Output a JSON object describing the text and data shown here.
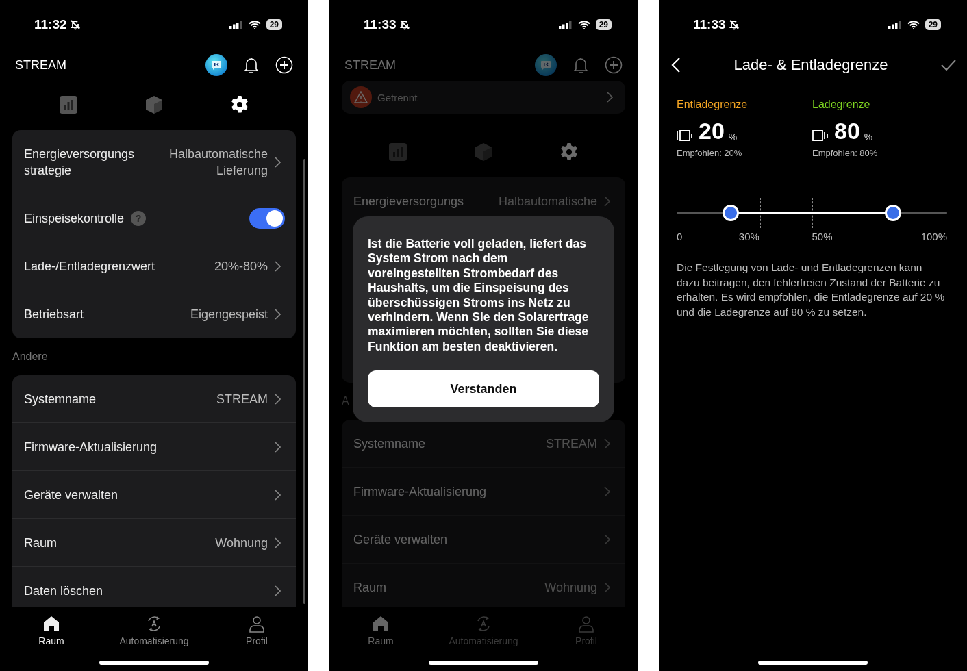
{
  "screens": [
    {
      "kind": "settings",
      "status_bar": {
        "time": "11:32",
        "battery": "29"
      },
      "header": {
        "title": "STREAM"
      },
      "view_tabs": [
        {
          "kind": "chart",
          "selected": false
        },
        {
          "kind": "cube",
          "selected": false
        },
        {
          "kind": "gear",
          "selected": true
        }
      ],
      "groups": [
        {
          "rows": [
            {
              "kind": "nav",
              "label": "Energieversorgungs strategie",
              "value": "Halbautomatische Lieferung"
            },
            {
              "kind": "toggle",
              "label": "Einspeisekontrolle",
              "help": "?",
              "on": true
            },
            {
              "kind": "nav",
              "label": "Lade-/Entladegrenzwert",
              "value": "20%-80%"
            },
            {
              "kind": "nav",
              "label": "Betriebsart",
              "value": "Eigengespeist"
            }
          ]
        },
        {
          "label": "Andere",
          "rows": [
            {
              "kind": "nav",
              "label": "Systemname",
              "value": "STREAM"
            },
            {
              "kind": "nav",
              "label": "Firmware-Aktualisierung"
            },
            {
              "kind": "nav",
              "label": "Geräte verwalten"
            },
            {
              "kind": "nav",
              "label": "Raum",
              "value": "Wohnung"
            },
            {
              "kind": "nav",
              "label": "Daten löschen"
            }
          ]
        }
      ],
      "bottom_nav": [
        {
          "kind": "home",
          "label": "Raum",
          "selected": true
        },
        {
          "kind": "automation",
          "label": "Automatisierung",
          "selected": false
        },
        {
          "kind": "profile",
          "label": "Profil",
          "selected": false
        }
      ]
    },
    {
      "kind": "settings",
      "status_bar": {
        "time": "11:33",
        "battery": "29"
      },
      "header": {
        "title": "STREAM"
      },
      "alert_banner": {
        "text": "Getrennt"
      },
      "view_tabs": [
        {
          "kind": "chart",
          "selected": false
        },
        {
          "kind": "cube",
          "selected": false
        },
        {
          "kind": "gear",
          "selected": true
        }
      ],
      "groups": [
        {
          "rows": [
            {
              "kind": "nav",
              "label": "Energieversorgungs",
              "value": "Halbautomatische"
            }
          ]
        },
        {
          "label": "A",
          "rows": [
            {
              "kind": "nav",
              "label": "Systemname",
              "value": "STREAM"
            },
            {
              "kind": "nav",
              "label": "Firmware-Aktualisierung"
            },
            {
              "kind": "nav",
              "label": "Geräte verwalten"
            },
            {
              "kind": "nav",
              "label": "Raum",
              "value": "Wohnung"
            }
          ]
        }
      ],
      "bottom_nav": [
        {
          "kind": "home",
          "label": "Raum",
          "selected": true
        },
        {
          "kind": "automation",
          "label": "Automatisierung",
          "selected": false
        },
        {
          "kind": "profile",
          "label": "Profil",
          "selected": false
        }
      ],
      "dialog": {
        "text": "Ist die Batterie voll geladen, liefert das System Strom nach dem voreingestellten Strombedarf des Haushalts, um die Einspeisung des überschüssigen Stroms ins Netz zu verhindern. Wenn Sie den Solarertrage maximieren möchten, sollten Sie diese Funktion am besten deaktivieren.",
        "button": "Verstanden"
      }
    },
    {
      "kind": "limits",
      "status_bar": {
        "time": "11:33",
        "battery": "29"
      },
      "header": {
        "title": "Lade- & Entladegrenze"
      },
      "limits": [
        {
          "label": "Entladegrenze",
          "color": "#f5a623",
          "value": "20",
          "unit": "%",
          "recommended": "Empfohlen: 20%",
          "level": 0.2
        },
        {
          "label": "Ladegrenze",
          "color": "#7ed321",
          "value": "80",
          "unit": "%",
          "recommended": "Empfohlen: 80%",
          "level": 0.8
        }
      ],
      "scale_labels": [
        "0",
        "30%",
        "50%",
        "100%"
      ],
      "description": "Die Festlegung von Lade- und Entladegrenzen kann dazu beitragen, den fehlerfreien Zustand der Batterie zu erhalten. Es wird empfohlen, die Entladegrenze auf 20 % und die Ladegrenze auf 80 % zu setzen."
    }
  ]
}
